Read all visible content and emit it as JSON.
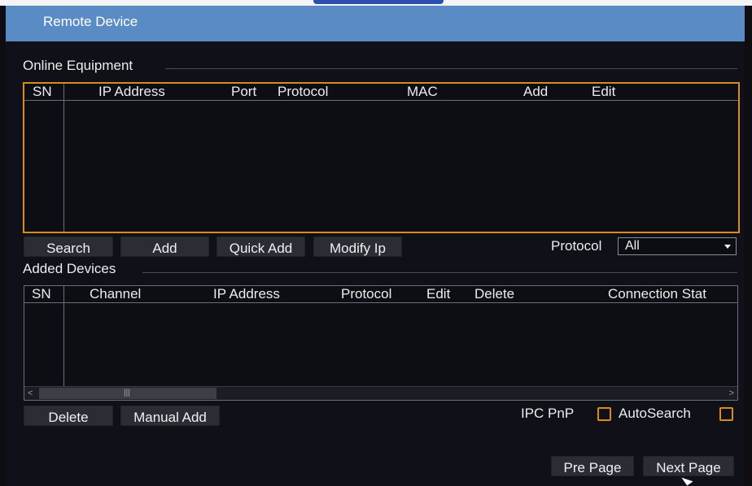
{
  "window": {
    "title": "Remote Device"
  },
  "online": {
    "section_label": "Online Equipment",
    "columns": [
      "SN",
      "IP Address",
      "Port",
      "Protocol",
      "MAC",
      "Add",
      "Edit"
    ],
    "buttons": {
      "search": "Search",
      "add": "Add",
      "quick_add": "Quick Add",
      "modify_ip": "Modify Ip"
    },
    "protocol_filter": {
      "label": "Protocol",
      "value": "All"
    }
  },
  "added": {
    "section_label": "Added Devices",
    "columns": [
      "SN",
      "Channel",
      "IP Address",
      "Protocol",
      "Edit",
      "Delete",
      "Connection Stat"
    ],
    "scroll": {
      "left": "<",
      "right": ">",
      "grip": "|||"
    },
    "buttons": {
      "delete": "Delete",
      "manual_add": "Manual Add"
    },
    "ipc_pnp": {
      "label": "IPC PnP",
      "checked": false
    },
    "auto_search": {
      "label": "AutoSearch",
      "checked": false
    }
  },
  "paging": {
    "prev": "Pre Page",
    "next": "Next Page"
  },
  "colors": {
    "titlebar": "#5b8bc4",
    "focus_border": "#d98c1a",
    "background": "#101118"
  }
}
